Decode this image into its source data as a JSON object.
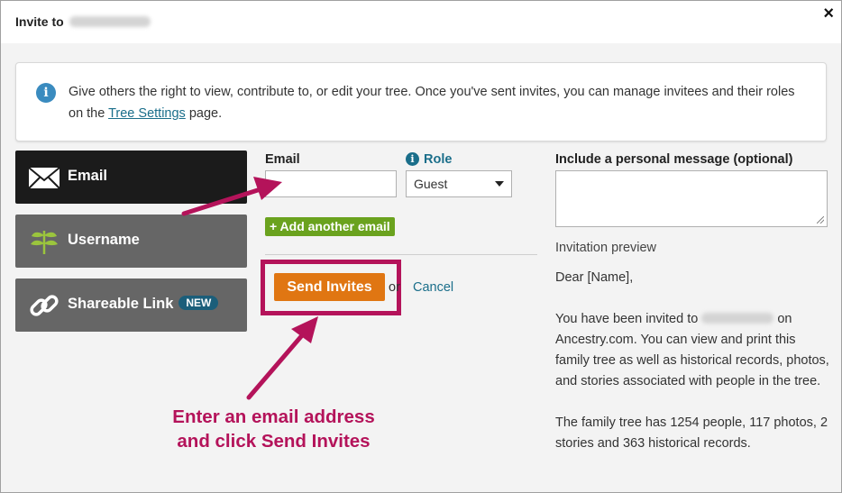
{
  "dialog": {
    "title": "Invite to",
    "close_symbol": "×"
  },
  "info": {
    "icon": "info-icon",
    "text_before_link": "Give others the right to view, contribute to, or edit your tree. Once you've sent invites, you can manage invitees and their roles on the ",
    "link_text": "Tree Settings",
    "text_after_link": " page."
  },
  "methods": [
    {
      "label": "Email",
      "icon": "envelope-icon",
      "active": true
    },
    {
      "label": "Username",
      "icon": "ancestry-leaf-icon",
      "active": false
    },
    {
      "label": "Shareable Link",
      "icon": "chain-link-icon",
      "badge": "NEW",
      "active": false
    }
  ],
  "form": {
    "email_label": "Email",
    "email_value": "",
    "role_label": "Role",
    "role_selected": "Guest",
    "add_email_label": "+ Add another email",
    "send_label": "Send Invites",
    "or_text": "or",
    "cancel_label": "Cancel"
  },
  "message": {
    "label": "Include a personal message (optional)",
    "value": "",
    "preview_label": "Invitation preview",
    "greeting": "Dear [Name],",
    "body_before_name": "You have been invited to ",
    "body_after_name": " on Ancestry.com. You can view and print this family tree as well as historical records, photos, and stories associated with people in the tree.",
    "stats": "The family tree has 1254 people, 117 photos, 2 stories and 363 historical records."
  },
  "annotation": {
    "line1": "Enter an email address",
    "line2": "and click Send Invites",
    "color": "#b4135a"
  },
  "colors": {
    "send_button": "#e07612",
    "add_email_button": "#6aa21e",
    "link": "#1a6e8a",
    "active_method": "#1b1b1b",
    "inactive_method": "#666666"
  }
}
